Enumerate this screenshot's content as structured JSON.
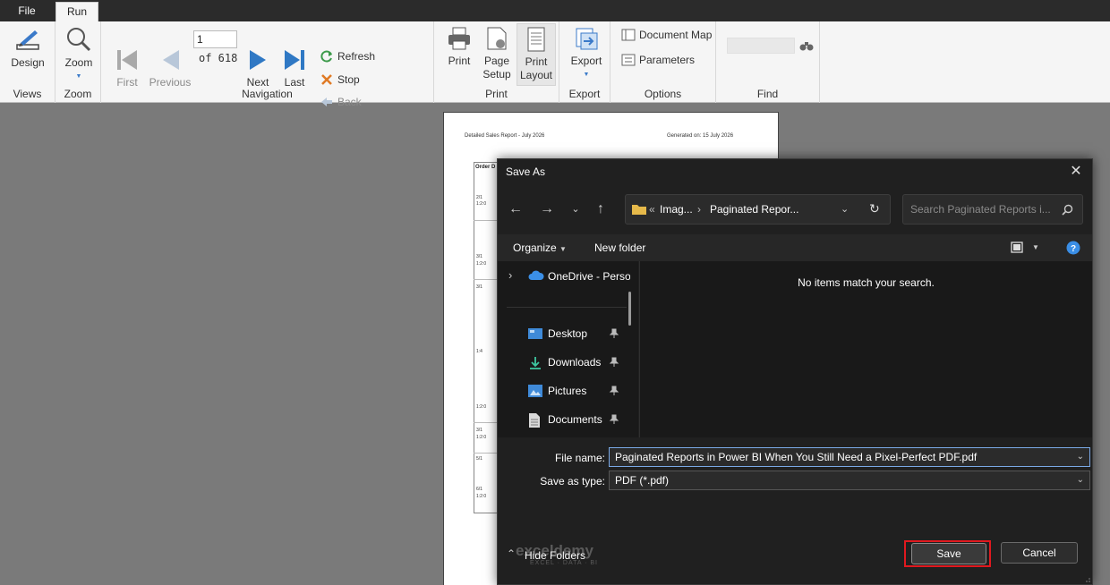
{
  "tabs": {
    "file": "File",
    "run": "Run"
  },
  "ribbon": {
    "views": {
      "design": "Design",
      "label": "Views"
    },
    "zoom": {
      "zoom": "Zoom",
      "label": "Zoom"
    },
    "navigation": {
      "first": "First",
      "previous": "Previous",
      "page_value": "1",
      "of_pages": "of  618",
      "next": "Next",
      "last": "Last",
      "refresh": "Refresh",
      "stop": "Stop",
      "back": "Back",
      "label": "Navigation"
    },
    "print": {
      "print": "Print",
      "page_setup_1": "Page",
      "page_setup_2": "Setup",
      "print_layout_1": "Print",
      "print_layout_2": "Layout",
      "label": "Print"
    },
    "export": {
      "export": "Export",
      "label": "Export"
    },
    "options": {
      "document_map": "Document Map",
      "parameters": "Parameters",
      "label": "Options"
    },
    "find": {
      "label": "Find"
    }
  },
  "report": {
    "title": "Detailed Sales Report - July 2026",
    "generated": "Generated on: 15 July 2026",
    "header": "Order D",
    "cells": [
      "2/1",
      "1:2:0",
      "3/1",
      "1:2:0",
      "3/1",
      "1:4",
      "1:2:0",
      "3/1",
      "1:2:0",
      "5/1",
      "6/1",
      "1:2:0",
      "6/1",
      "1:2:0"
    ]
  },
  "dialog": {
    "title": "Save As",
    "address": {
      "prefix": "«",
      "crumb1": "Imag...",
      "crumb2": "Paginated Repor..."
    },
    "search_placeholder": "Search Paginated Reports i...",
    "organize": "Organize",
    "new_folder": "New folder",
    "nav": {
      "onedrive": "OneDrive - Perso",
      "desktop": "Desktop",
      "downloads": "Downloads",
      "pictures": "Pictures",
      "documents": "Documents"
    },
    "empty_message": "No items match your search.",
    "file_name_label": "File name:",
    "file_name_value": "Paginated Reports in Power BI When You Still Need a Pixel-Perfect PDF.pdf",
    "save_type_label": "Save as type:",
    "save_type_value": "PDF (*.pdf)",
    "hide_folders": "Hide Folders",
    "save": "Save",
    "cancel": "Cancel",
    "watermark_1": "exceldemy",
    "watermark_2": "EXCEL · DATA · BI"
  }
}
